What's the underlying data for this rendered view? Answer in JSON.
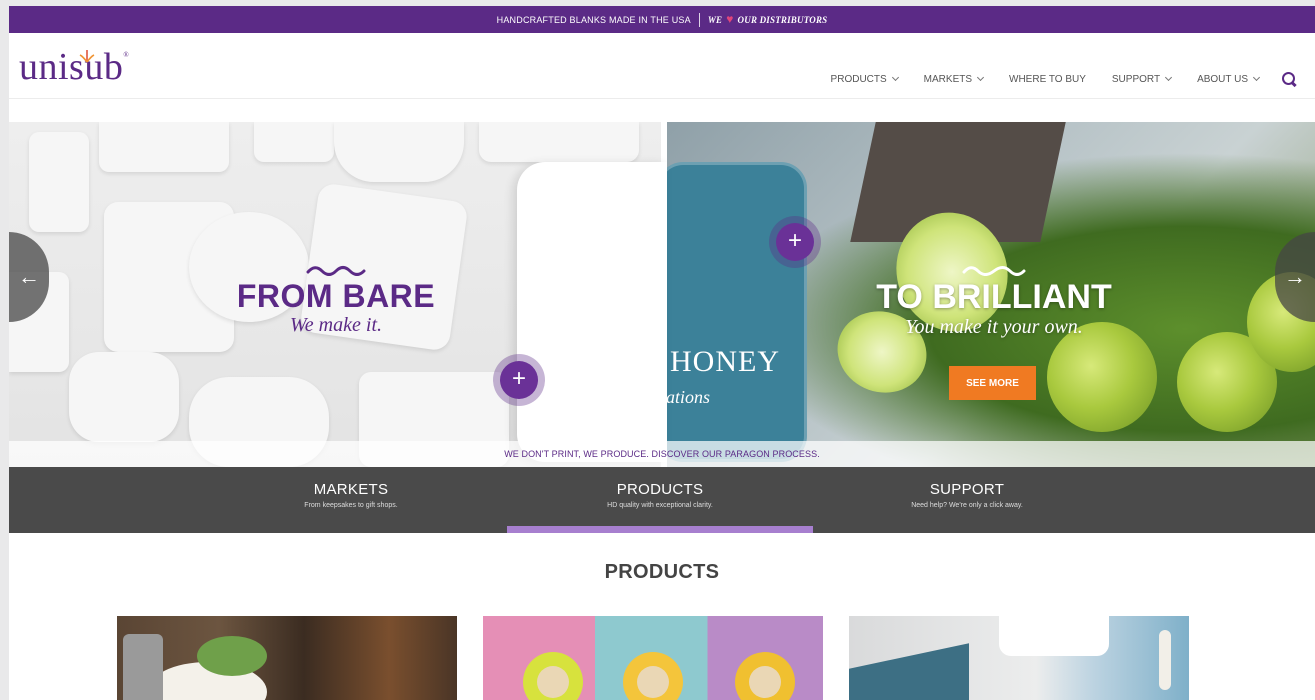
{
  "topbar": {
    "tagline": "HANDCRAFTED BLANKS MADE IN THE USA",
    "distributors_we": "WE",
    "distributors_text": "OUR DISTRIBUTORS"
  },
  "header": {
    "logo_text": "unisub",
    "logo_reg": "®",
    "nav": [
      {
        "label": "PRODUCTS",
        "dropdown": true
      },
      {
        "label": "MARKETS",
        "dropdown": true
      },
      {
        "label": "WHERE TO BUY",
        "dropdown": false
      },
      {
        "label": "SUPPORT",
        "dropdown": true
      },
      {
        "label": "ABOUT US",
        "dropdown": true
      }
    ]
  },
  "hero": {
    "left_heading": "FROM BARE",
    "left_sub": "We make it.",
    "right_heading": "TO BRILLIANT",
    "right_sub": "You make it your own.",
    "board_text": "HONEY",
    "board_sub": "ations",
    "cta": "SEE MORE",
    "plus": "+",
    "prev_arrow": "←",
    "next_arrow": "→",
    "paragon": "WE DON'T PRINT, WE PRODUCE. DISCOVER OUR PARAGON PROCESS."
  },
  "categories": [
    {
      "title": "MARKETS",
      "desc": "From keepsakes to gift shops."
    },
    {
      "title": "PRODUCTS",
      "desc": "HD quality with exceptional clarity."
    },
    {
      "title": "SUPPORT",
      "desc": "Need help? We're only a click away."
    }
  ],
  "products": {
    "title": "PRODUCTS"
  },
  "colors": {
    "brand_purple": "#5b2a86",
    "accent_orange": "#f07a22",
    "dark_bar": "#4a4a4a",
    "underline": "#a77fcf"
  }
}
